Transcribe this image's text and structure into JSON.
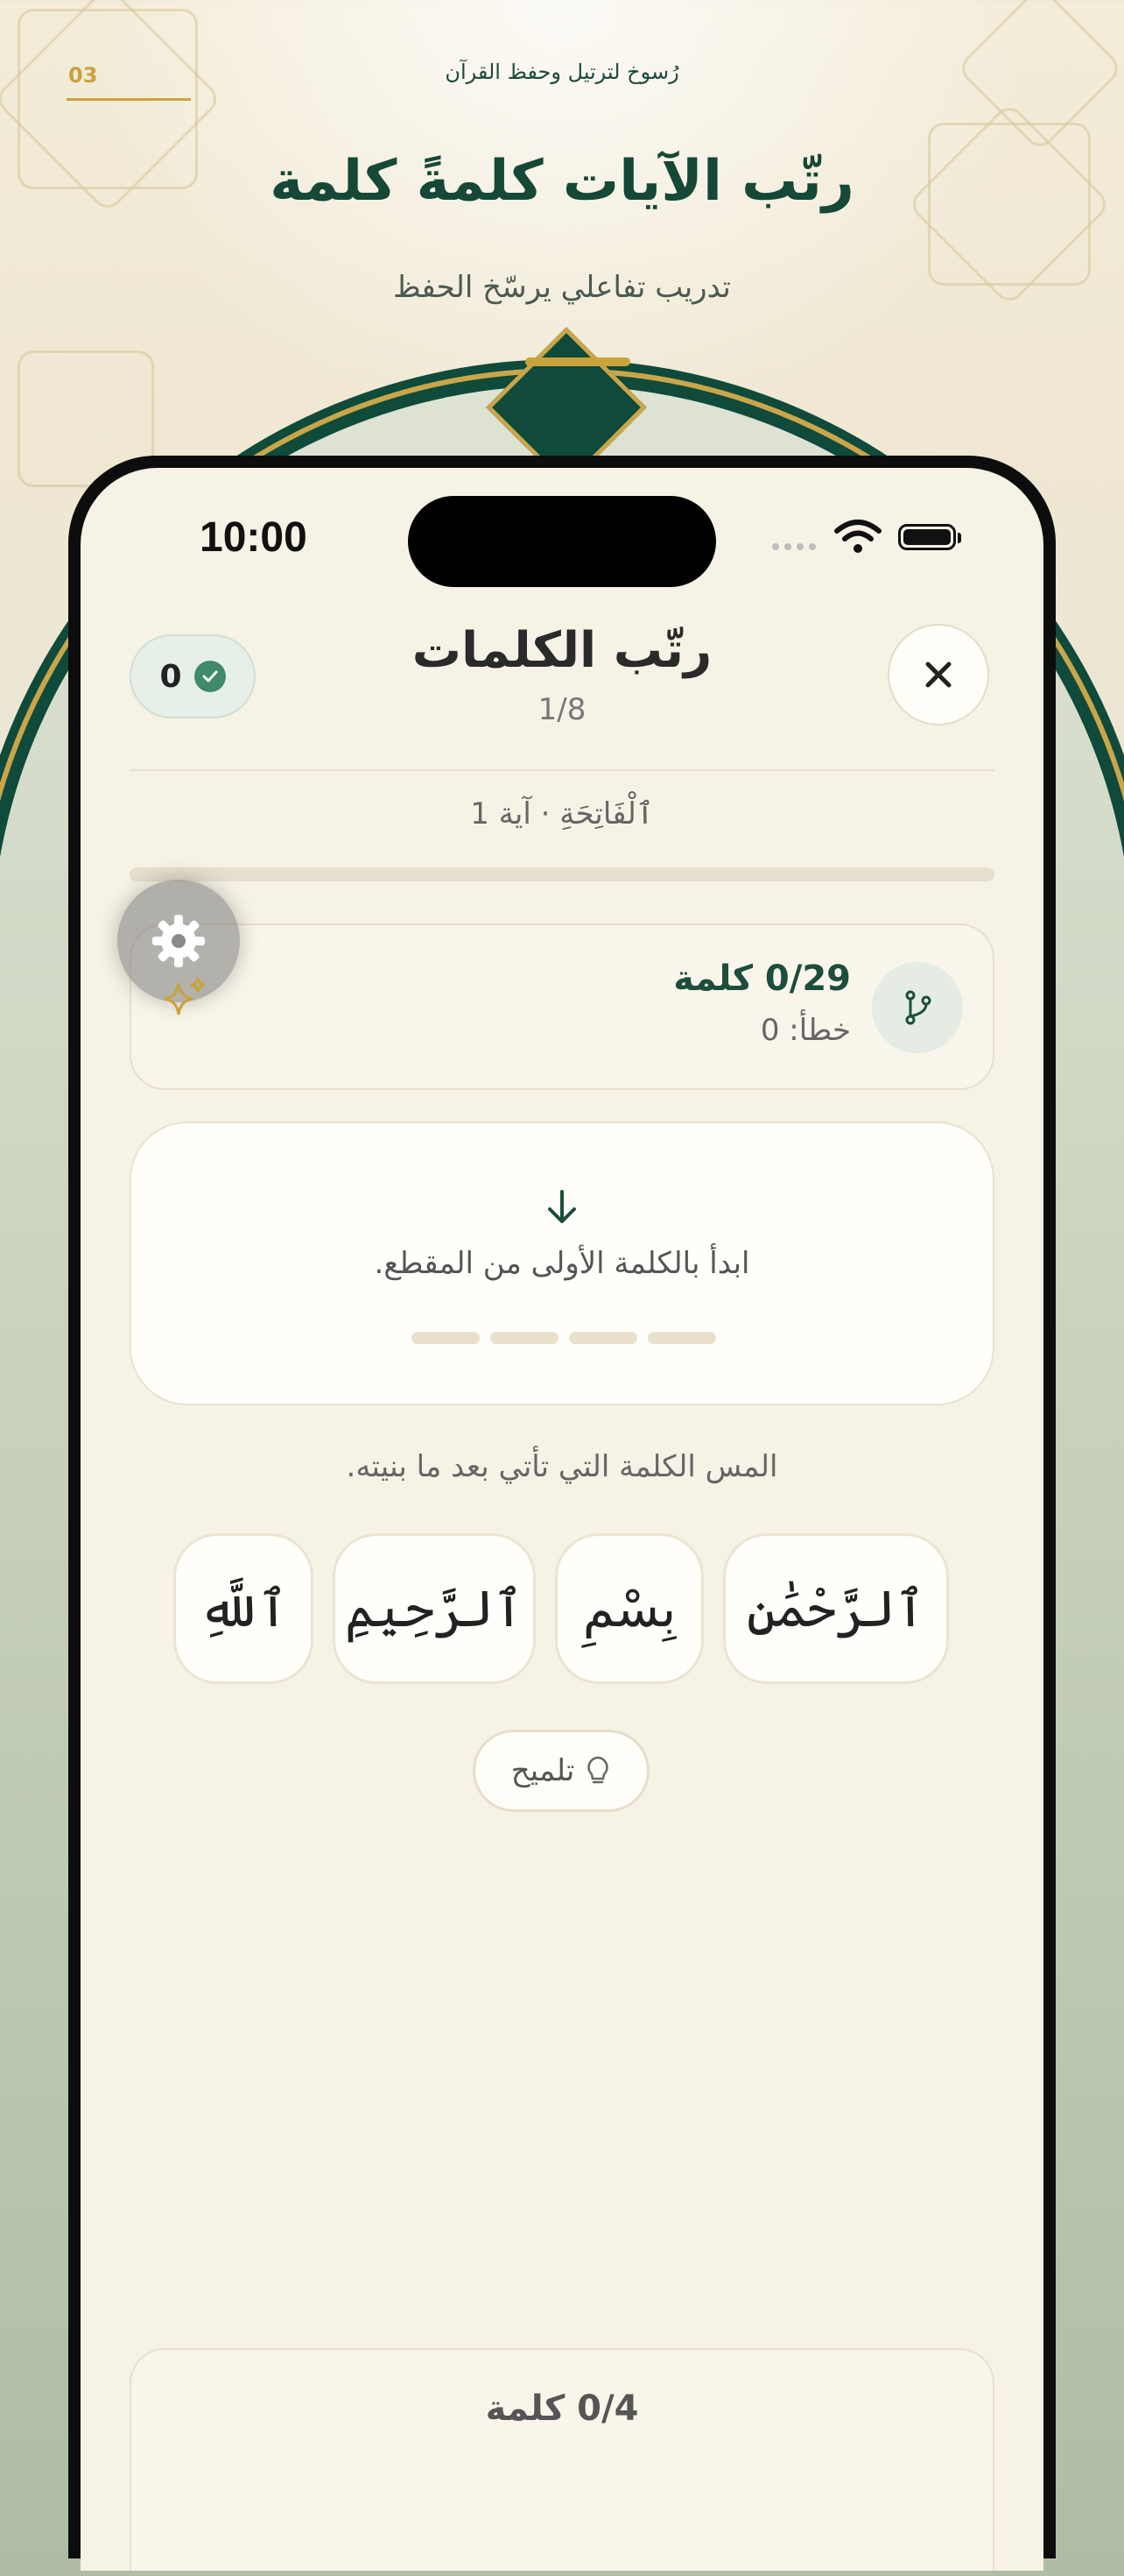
{
  "banner": {
    "step_number": "03",
    "brand": "رُسوخ لترتيل وحفظ القرآن",
    "headline": "رتّب الآيات كلمةً كلمة",
    "subheadline": "تدريب تفاعلي يرسّخ الحفظ"
  },
  "status_bar": {
    "time": "10:00"
  },
  "screen": {
    "title": "رتّب الكلمات",
    "progress": "1/8",
    "correct_count": "0",
    "surah_label": "ٱلْفَاتِحَةِ · آية 1",
    "stats": {
      "words": "0/29 كلمة",
      "mistakes": "خطأ: 0"
    },
    "drop_zone": {
      "prompt": "ابدأ بالكلمة الأولى من المقطع."
    },
    "instruction": "المس الكلمة التي تأتي بعد ما بنيته.",
    "word_choices": [
      "ٱلرَّحْمَٰنِ",
      "بِسْمِ",
      "ٱلرَّحِيمِ",
      "ٱللَّهِ"
    ],
    "hint_label": "تلميح",
    "bottom_words": "0/4 كلمة"
  },
  "colors": {
    "primary": "#154836",
    "gold": "#c9a23a",
    "success": "#3f8a67",
    "background": "#f6f2e6"
  },
  "icons": [
    "close-icon",
    "check-icon",
    "branch-icon",
    "gear-icon",
    "sparkle-icon",
    "arrow-down-icon",
    "lightbulb-icon",
    "wifi-icon",
    "battery-icon"
  ]
}
